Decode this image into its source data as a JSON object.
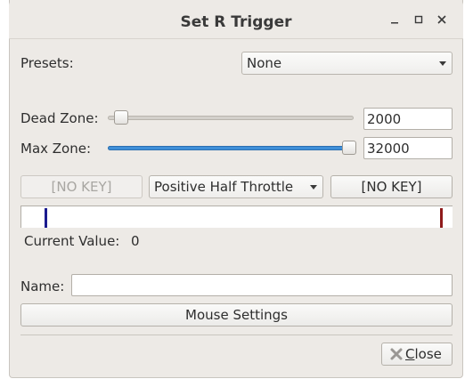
{
  "window": {
    "title": "Set R Trigger"
  },
  "presets": {
    "label": "Presets:",
    "selected": "None"
  },
  "dead_zone": {
    "label": "Dead Zone:",
    "value": "2000",
    "slider_fraction": 0.05
  },
  "max_zone": {
    "label": "Max Zone:",
    "value": "32000",
    "slider_fraction": 0.98
  },
  "key_left": {
    "label": "[NO KEY]",
    "disabled": true
  },
  "throttle": {
    "selected": "Positive Half Throttle"
  },
  "key_right": {
    "label": "[NO KEY]"
  },
  "current": {
    "label": "Current Value:",
    "value": "0"
  },
  "name": {
    "label": "Name:",
    "value": ""
  },
  "mouse_settings": {
    "label": "Mouse Settings"
  },
  "close": {
    "prefix": "",
    "underlined": "C",
    "rest": "lose",
    "icon": "close-x-icon"
  },
  "colors": {
    "accent": "#3f8fd8",
    "low_marker": "#1b1b8f",
    "high_marker": "#8f1b1b"
  }
}
